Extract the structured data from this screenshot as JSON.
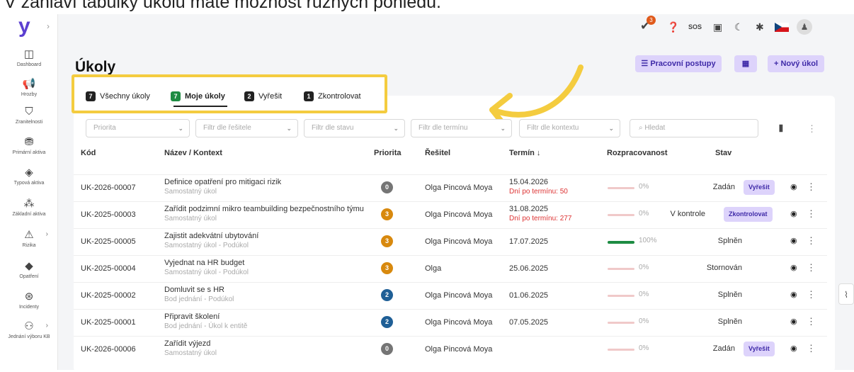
{
  "caption": "V záhlaví tabulky úkolů máte možnost různých pohledů.",
  "brand": {
    "logo": "y"
  },
  "sidebar": {
    "items": [
      {
        "label": "Dashboard",
        "icon": "dashboard-icon",
        "glyph": "◫"
      },
      {
        "label": "Hrozby",
        "icon": "megaphone-icon",
        "glyph": "📢"
      },
      {
        "label": "Zranitelnosti",
        "icon": "shield-icon",
        "glyph": "⛉"
      },
      {
        "label": "Primární aktiva",
        "icon": "assets-icon",
        "glyph": "⛃"
      },
      {
        "label": "Typová aktiva",
        "icon": "tag-icon",
        "glyph": "◈"
      },
      {
        "label": "Základní aktiva",
        "icon": "grid-icon",
        "glyph": "⁂"
      },
      {
        "label": "Rizika",
        "icon": "warning-icon",
        "glyph": "⚠"
      },
      {
        "label": "Opatření",
        "icon": "diamond-icon",
        "glyph": "◆"
      },
      {
        "label": "Incidenty",
        "icon": "incident-icon",
        "glyph": "⊛"
      },
      {
        "label": "Jednání výboru KB",
        "icon": "people-icon",
        "glyph": "⚇"
      }
    ]
  },
  "topbar": {
    "notification_count": "3",
    "sos_label": "SOS",
    "icons": [
      "tasks-icon",
      "help-icon",
      "sos-icon",
      "pdf-icon",
      "moon-icon",
      "settings-icon",
      "flag-cz-icon",
      "user-icon"
    ]
  },
  "page": {
    "title": "Úkoly",
    "buttons": {
      "workflows": "Pracovní postupy",
      "new_task": "+ Nový úkol"
    }
  },
  "tabs": [
    {
      "count": "7",
      "label": "Všechny úkoly"
    },
    {
      "count": "7",
      "label": "Moje úkoly",
      "active": true
    },
    {
      "count": "2",
      "label": "Vyřešit"
    },
    {
      "count": "1",
      "label": "Zkontrolovat"
    }
  ],
  "filters": {
    "priority": "Priorita",
    "solver": "Filtr dle řešitele",
    "state": "Filtr dle stavu",
    "deadline": "Filtr dle termínu",
    "context": "Filtr dle kontextu",
    "search": "Hledat"
  },
  "table": {
    "headers": {
      "code": "Kód",
      "name": "Název / Kontext",
      "priority": "Priorita",
      "solver": "Řešitel",
      "deadline": "Termín ↓",
      "progress": "Rozpracovanost",
      "state": "Stav"
    },
    "rows": [
      {
        "code": "UK-2026-00007",
        "name": "Definice opatření pro mitigaci rizik",
        "context": "Samostatný úkol",
        "priority": "0",
        "priority_color": "#757575",
        "solver": "Olga Pincová Moya",
        "deadline": "15.04.2026",
        "deadline_note": "Dní po termínu: 50",
        "progress": "0%",
        "progress_value": 0,
        "state": "Zadán",
        "action": "Vyřešit"
      },
      {
        "code": "UK-2025-00003",
        "name": "Zařídit podzimní mikro teambuilding bezpečnostního týmu",
        "context": "Samostatný úkol",
        "priority": "3",
        "priority_color": "#d8890e",
        "solver": "Olga Pincová Moya",
        "deadline": "31.08.2025",
        "deadline_note": "Dní po termínu: 277",
        "progress": "0%",
        "progress_value": 0,
        "state": "V kontrole",
        "action": "Zkontrolovat"
      },
      {
        "code": "UK-2025-00005",
        "name": "Zajistit adekvátní ubytování",
        "context": "Samostatný úkol - Podúkol",
        "priority": "3",
        "priority_color": "#d8890e",
        "solver": "Olga Pincová Moya",
        "deadline": "17.07.2025",
        "deadline_note": "",
        "progress": "100%",
        "progress_value": 100,
        "state": "Splněn",
        "action": ""
      },
      {
        "code": "UK-2025-00004",
        "name": "Vyjednat na HR budget",
        "context": "Samostatný úkol - Podúkol",
        "priority": "3",
        "priority_color": "#d8890e",
        "solver": "Olga",
        "deadline": "25.06.2025",
        "deadline_note": "",
        "progress": "0%",
        "progress_value": 0,
        "state": "Stornován",
        "action": ""
      },
      {
        "code": "UK-2025-00002",
        "name": "Domluvit se s HR",
        "context": "Bod jednání - Podúkol",
        "priority": "2",
        "priority_color": "#1f5f96",
        "solver": "Olga Pincová Moya",
        "deadline": "01.06.2025",
        "deadline_note": "",
        "progress": "0%",
        "progress_value": 0,
        "state": "Splněn",
        "action": ""
      },
      {
        "code": "UK-2025-00001",
        "name": "Připravit školení",
        "context": "Bod jednání - Úkol k entitě",
        "priority": "2",
        "priority_color": "#1f5f96",
        "solver": "Olga Pincová Moya",
        "deadline": "07.05.2025",
        "deadline_note": "",
        "progress": "0%",
        "progress_value": 0,
        "state": "Splněn",
        "action": ""
      },
      {
        "code": "UK-2026-00006",
        "name": "Zařídit výjezd",
        "context": "Samostatný úkol",
        "priority": "0",
        "priority_color": "#757575",
        "solver": "Olga Pincová Moya",
        "deadline": "",
        "deadline_note": "",
        "progress": "0%",
        "progress_value": 0,
        "state": "Zadán",
        "action": "Vyřešit"
      }
    ]
  },
  "colors": {
    "accent": "#5b3fd0",
    "highlight": "#f4cc3f",
    "success": "#1e8c43",
    "danger": "#d33333"
  }
}
